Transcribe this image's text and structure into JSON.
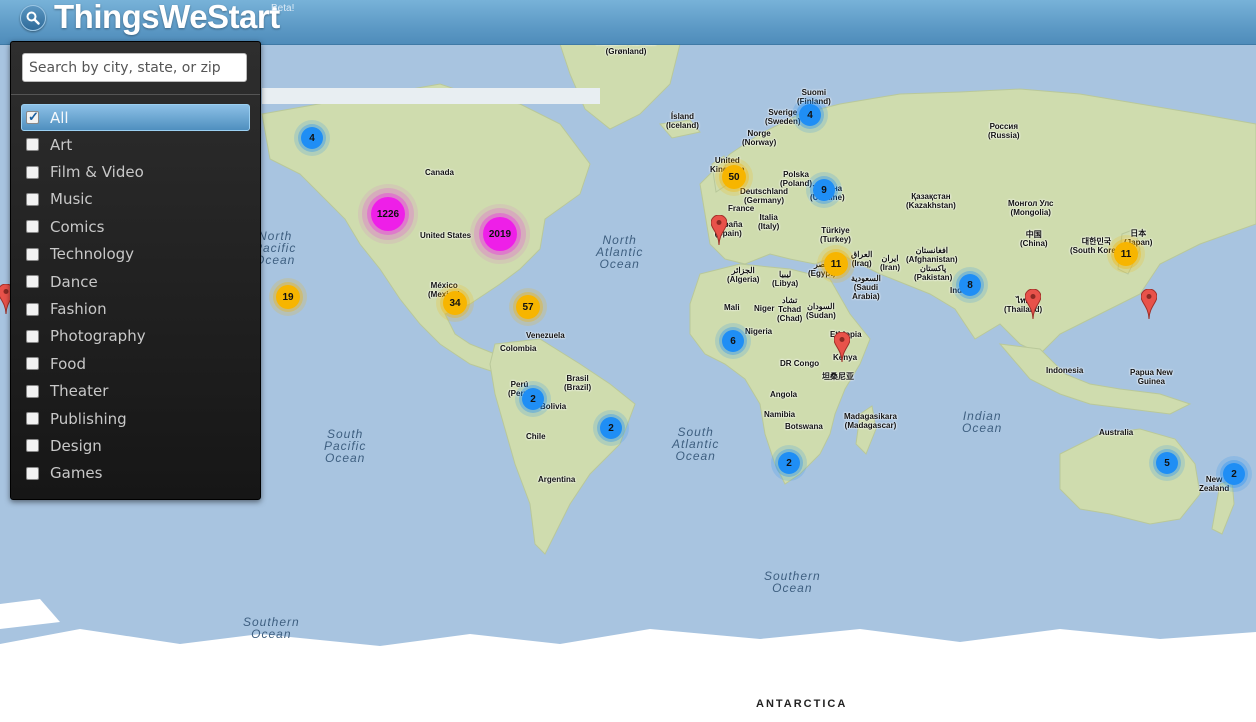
{
  "header": {
    "title": "ThingsWeStart",
    "beta": "Beta!",
    "search_icon": "magnifier-icon"
  },
  "search": {
    "placeholder": "Search by city, state, or zip",
    "value": ""
  },
  "categories": [
    {
      "label": "All",
      "checked": true
    },
    {
      "label": "Art",
      "checked": false
    },
    {
      "label": "Film & Video",
      "checked": false
    },
    {
      "label": "Music",
      "checked": false
    },
    {
      "label": "Comics",
      "checked": false
    },
    {
      "label": "Technology",
      "checked": false
    },
    {
      "label": "Dance",
      "checked": false
    },
    {
      "label": "Fashion",
      "checked": false
    },
    {
      "label": "Photography",
      "checked": false
    },
    {
      "label": "Food",
      "checked": false
    },
    {
      "label": "Theater",
      "checked": false
    },
    {
      "label": "Publishing",
      "checked": false
    },
    {
      "label": "Design",
      "checked": false
    },
    {
      "label": "Games",
      "checked": false
    }
  ],
  "map": {
    "colors": {
      "ocean": "#a8c4e0",
      "land": "#cfdcae",
      "ice": "#ffffff",
      "blue_cluster": "#1f8ef5",
      "yellow_cluster": "#f7b500",
      "magenta_cluster": "#ee1fe8",
      "pin": "#e8524a"
    },
    "clusters": [
      {
        "count": "4",
        "color": "blue"
      },
      {
        "count": "1226",
        "color": "magenta"
      },
      {
        "count": "2019",
        "color": "magenta"
      },
      {
        "count": "19",
        "color": "yellow"
      },
      {
        "count": "34",
        "color": "yellow"
      },
      {
        "count": "57",
        "color": "yellow"
      },
      {
        "count": "2",
        "color": "blue"
      },
      {
        "count": "2",
        "color": "blue"
      },
      {
        "count": "50",
        "color": "yellow"
      },
      {
        "count": "4",
        "color": "blue"
      },
      {
        "count": "9",
        "color": "blue"
      },
      {
        "count": "11",
        "color": "yellow"
      },
      {
        "count": "6",
        "color": "blue"
      },
      {
        "count": "2",
        "color": "blue"
      },
      {
        "count": "8",
        "color": "blue"
      },
      {
        "count": "11",
        "color": "yellow"
      },
      {
        "count": "5",
        "color": "blue"
      },
      {
        "count": "2",
        "color": "blue"
      }
    ],
    "labels": {
      "greenland": "Kalaallit Nunaat\n(Grønland)",
      "iceland": "Ísland\n(Iceland)",
      "canada": "Canada",
      "united_states": "United States",
      "mexico": "México\n(Mexico)",
      "venezuela": "Venezuela",
      "colombia": "Colombia",
      "peru": "Perú\n(Peru)",
      "brasil": "Brasil\n(Brazil)",
      "bolivia": "Bolivia",
      "chile": "Chile",
      "argentina": "Argentina",
      "suomi": "Suomi\n(Finland)",
      "sverige": "Sverige\n(Sweden)",
      "norge": "Norge\n(Norway)",
      "uk": "United\nKingdom",
      "deutschland": "Deutschland\n(Germany)",
      "polska": "Polska\n(Poland)",
      "ukraine": "Україна\n(Ukraine)",
      "france": "France",
      "espana": "España\n(Spain)",
      "italia": "Italia\n(Italy)",
      "turkiye": "Türkiye\n(Turkey)",
      "russia": "Россия\n(Russia)",
      "kazakhstan": "Қазақстан\n(Kazakhstan)",
      "mongolia": "Монгол Улс\n(Mongolia)",
      "china": "中国\n(China)",
      "japan": "日本\n(Japan)",
      "south_korea": "대한민국\n(South Korea)",
      "iraq": "العراق\n(Iraq)",
      "iran": "ایران\n(Iran)",
      "afghanistan": "افغانستان\n(Afghanistan)",
      "pakistan": "پاکستان\n(Pakistan)",
      "saudi": "السعودية\n(Saudi\nArabia)",
      "egypt": "مصر\n(Egypt)",
      "algeria": "الجزائر\n(Algeria)",
      "libya": "ليبيا\n(Libya)",
      "mali": "Mali",
      "niger": "Niger",
      "tchad": "تشاد\nTchad\n(Chad)",
      "sudan": "السودان\n(Sudan)",
      "ethiopia": "Ethiopia",
      "nigeria": "Nigeria",
      "dr_congo": "DR Congo",
      "kenya": "Kenya",
      "tanzania": "坦桑尼亚",
      "angola": "Angola",
      "namibia": "Namibia",
      "botswana": "Botswana",
      "madagasikara": "Madagasikara\n(Madagascar)",
      "india": "India",
      "thailand": "ไทย\n(Thailand)",
      "indonesia": "Indonesia",
      "papua": "Papua New\nGuinea",
      "australia": "Australia",
      "new_zealand": "New\nZealand"
    },
    "oceans": {
      "north_atlantic": "North\nAtlantic\nOcean",
      "north_pacific": "North\nPacific\nOcean",
      "south_pacific": "South\nPacific\nOcean",
      "south_atlantic": "South\nAtlantic\nOcean",
      "indian": "Indian\nOcean",
      "southern_1": "Southern\nOcean",
      "southern_2": "Southern\nOcean"
    },
    "antarctica": "ANTARCTICA"
  }
}
